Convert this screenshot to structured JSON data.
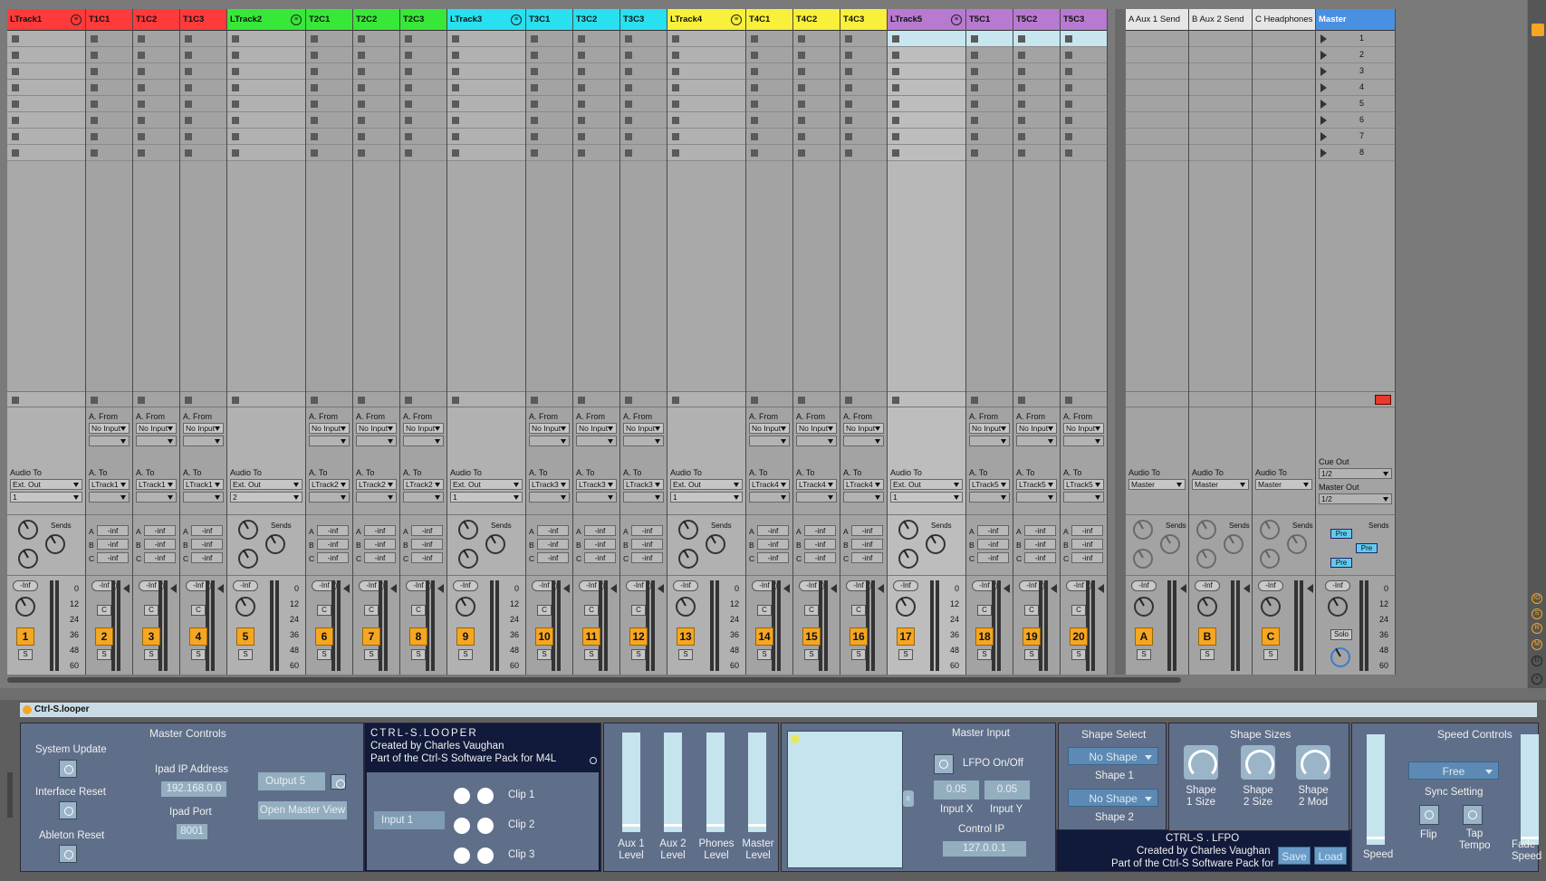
{
  "tracks": [
    {
      "name": "LTrack1",
      "color": "#ff3a3a",
      "type": "group",
      "audio_label": "Audio To",
      "route": "Ext. Out",
      "chan": "1",
      "num": "1"
    },
    {
      "name": "T1C1",
      "color": "#ff3a3a",
      "type": "child",
      "from_label": "A. From",
      "from": "No Input",
      "to_label": "A. To",
      "route": "LTrack1",
      "num": "2"
    },
    {
      "name": "T1C2",
      "color": "#ff3a3a",
      "type": "child",
      "from_label": "A. From",
      "from": "No Input",
      "to_label": "A. To",
      "route": "LTrack1",
      "num": "3"
    },
    {
      "name": "T1C3",
      "color": "#ff3a3a",
      "type": "child",
      "from_label": "A. From",
      "from": "No Input",
      "to_label": "A. To",
      "route": "LTrack1",
      "num": "4"
    },
    {
      "name": "LTrack2",
      "color": "#38e838",
      "type": "group",
      "audio_label": "Audio To",
      "route": "Ext. Out",
      "chan": "2",
      "num": "5"
    },
    {
      "name": "T2C1",
      "color": "#38e838",
      "type": "child",
      "from_label": "A. From",
      "from": "No Input",
      "to_label": "A. To",
      "route": "LTrack2",
      "num": "6"
    },
    {
      "name": "T2C2",
      "color": "#38e838",
      "type": "child",
      "from_label": "A. From",
      "from": "No Input",
      "to_label": "A. To",
      "route": "LTrack2",
      "num": "7"
    },
    {
      "name": "T2C3",
      "color": "#38e838",
      "type": "child",
      "from_label": "A. From",
      "from": "No Input",
      "to_label": "A. To",
      "route": "LTrack2",
      "num": "8"
    },
    {
      "name": "LTrack3",
      "color": "#28e0f0",
      "type": "group",
      "audio_label": "Audio To",
      "route": "Ext. Out",
      "chan": "1",
      "num": "9"
    },
    {
      "name": "T3C1",
      "color": "#28e0f0",
      "type": "child",
      "from_label": "A. From",
      "from": "No Input",
      "to_label": "A. To",
      "route": "LTrack3",
      "num": "10"
    },
    {
      "name": "T3C2",
      "color": "#28e0f0",
      "type": "child",
      "from_label": "A. From",
      "from": "No Input",
      "to_label": "A. To",
      "route": "LTrack3",
      "num": "11"
    },
    {
      "name": "T3C3",
      "color": "#28e0f0",
      "type": "child",
      "from_label": "A. From",
      "from": "No Input",
      "to_label": "A. To",
      "route": "LTrack3",
      "num": "12"
    },
    {
      "name": "LTrack4",
      "color": "#f8f03a",
      "type": "group",
      "audio_label": "Audio To",
      "route": "Ext. Out",
      "chan": "1",
      "num": "13"
    },
    {
      "name": "T4C1",
      "color": "#f8f03a",
      "type": "child",
      "from_label": "A. From",
      "from": "No Input",
      "to_label": "A. To",
      "route": "LTrack4",
      "num": "14"
    },
    {
      "name": "T4C2",
      "color": "#f8f03a",
      "type": "child",
      "from_label": "A. From",
      "from": "No Input",
      "to_label": "A. To",
      "route": "LTrack4",
      "num": "15"
    },
    {
      "name": "T4C3",
      "color": "#f8f03a",
      "type": "child",
      "from_label": "A. From",
      "from": "No Input",
      "to_label": "A. To",
      "route": "LTrack4",
      "num": "16"
    },
    {
      "name": "LTrack5",
      "color": "#b77ad0",
      "type": "group",
      "audio_label": "Audio To",
      "route": "Ext. Out",
      "chan": "1",
      "num": "17",
      "selected": true
    },
    {
      "name": "T5C1",
      "color": "#b77ad0",
      "type": "child",
      "from_label": "A. From",
      "from": "No Input",
      "to_label": "A. To",
      "route": "LTrack5",
      "num": "18"
    },
    {
      "name": "T5C2",
      "color": "#b77ad0",
      "type": "child",
      "from_label": "A. From",
      "from": "No Input",
      "to_label": "A. To",
      "route": "LTrack5",
      "num": "19"
    },
    {
      "name": "T5C3",
      "color": "#b77ad0",
      "type": "child",
      "from_label": "A. From",
      "from": "No Input",
      "to_label": "A. To",
      "route": "LTrack5",
      "num": "20"
    }
  ],
  "returns": [
    {
      "name": "A Aux 1 Send",
      "audio_label": "Audio To",
      "route": "Master",
      "num": "A"
    },
    {
      "name": "B Aux 2 Send",
      "audio_label": "Audio To",
      "route": "Master",
      "num": "B"
    },
    {
      "name": "C Headphones",
      "audio_label": "Audio To",
      "route": "Master",
      "num": "C"
    }
  ],
  "master": {
    "name": "Master",
    "color": "#4a90e2",
    "scenes": [
      "1",
      "2",
      "3",
      "4",
      "5",
      "6",
      "7",
      "8"
    ],
    "cue_label": "Cue Out",
    "cue": "1/2",
    "out_label": "Master Out",
    "out": "1/2",
    "pre": "Pre",
    "solo": "Solo"
  },
  "mixer": {
    "sends_label": "Sends",
    "inf": "-inf",
    "inf_cap": "-Inf",
    "c_btn": "C",
    "s_btn": "S",
    "send_letters": [
      "A",
      "B",
      "C"
    ],
    "scale": [
      "0",
      "12",
      "24",
      "36",
      "48",
      "60"
    ]
  },
  "device": {
    "title": "Ctrl-S.looper",
    "master_controls": {
      "title": "Master Controls",
      "system_update": "System Update",
      "interface_reset": "Interface Reset",
      "ableton_reset": "Ableton Reset",
      "ip_label": "Ipad IP Address",
      "ip": "192.168.0.0",
      "port_label": "Ipad Port",
      "port": "8001",
      "output": "Output 5",
      "open_master": "Open Master View"
    },
    "looper": {
      "title": "CTRL-S.LOOPER",
      "credit": "Created by Charles Vaughan",
      "pack": "Part of the Ctrl-S Software Pack for M4L",
      "input": "Input 1",
      "clips": [
        "Clip 1",
        "Clip 2",
        "Clip 3"
      ]
    },
    "levels": [
      "Aux 1 Level",
      "Aux 2 Level",
      "Phones Level",
      "Master Level"
    ],
    "lfpo": {
      "master_input": "Master Input",
      "onoff": "LFPO On/Off",
      "x": "0.05",
      "y": "0.05",
      "x_label": "Input X",
      "y_label": "Input Y",
      "ip_label": "Control IP",
      "ip": "127.0.0.1",
      "title": "CTRL-S . LFPO",
      "credit": "Created by Charles Vaughan",
      "pack": "Part of the Ctrl-S Software Pack for",
      "save": "Save",
      "load": "Load"
    },
    "shape_select": {
      "title": "Shape Select",
      "s1": "No Shape",
      "l1": "Shape 1",
      "s2": "No Shape",
      "l2": "Shape 2"
    },
    "shape_sizes": {
      "title": "Shape Sizes",
      "k1": "Shape 1 Size",
      "k2": "Shape 2 Size",
      "k3": "Shape 2 Mod"
    },
    "speed": {
      "title": "Speed Controls",
      "mode": "Free",
      "sync": "Sync Setting",
      "flip": "Flip",
      "tap": "Tap Tempo",
      "speed": "Speed",
      "fade": "Fade Speed"
    }
  }
}
